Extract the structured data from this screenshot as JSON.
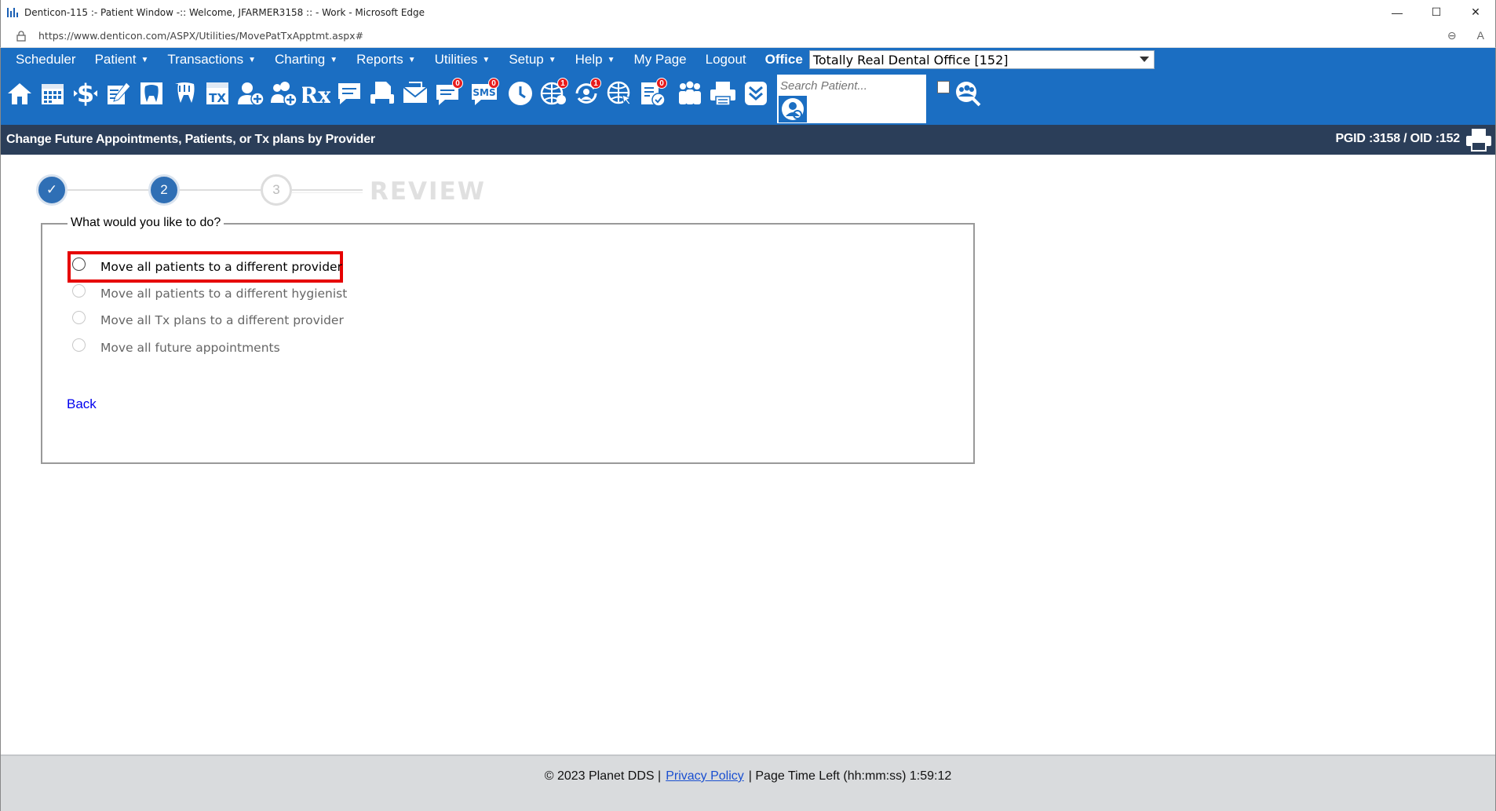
{
  "window": {
    "title": "Denticon-115 :- Patient Window -:: Welcome, JFARMER3158 :: - Work - Microsoft Edge",
    "url": "https://www.denticon.com/ASPX/Utilities/MovePatTxApptmt.aspx#"
  },
  "menu": {
    "items": [
      {
        "label": "Scheduler",
        "caret": false
      },
      {
        "label": "Patient",
        "caret": true
      },
      {
        "label": "Transactions",
        "caret": true
      },
      {
        "label": "Charting",
        "caret": true
      },
      {
        "label": "Reports",
        "caret": true
      },
      {
        "label": "Utilities",
        "caret": true
      },
      {
        "label": "Setup",
        "caret": true
      },
      {
        "label": "Help",
        "caret": true
      },
      {
        "label": "My Page",
        "caret": false
      },
      {
        "label": "Logout",
        "caret": false
      }
    ],
    "office_label": "Office",
    "office_value": "Totally Real Dental Office [152]"
  },
  "toolbar": {
    "badges": {
      "messages": "0",
      "sms": "0",
      "web": "1",
      "sync": "1",
      "forms": "0"
    },
    "sms_text": "SMS",
    "tx_text": "TX",
    "search_placeholder": "Search Patient..."
  },
  "page": {
    "title": "Change Future Appointments, Patients, or Tx plans by Provider",
    "ids": "PGID :3158  /  OID :152"
  },
  "wizard": {
    "step1": "✓",
    "step2": "2",
    "step3": "3",
    "review": "REVIEW"
  },
  "form": {
    "legend": "What would you like to do?",
    "options": [
      {
        "label": "Move all patients to a different provider",
        "enabled": true
      },
      {
        "label": "Move all patients to a different hygienist",
        "enabled": false
      },
      {
        "label": "Move all Tx plans to a different provider",
        "enabled": false
      },
      {
        "label": "Move all future appointments",
        "enabled": false
      }
    ],
    "back": "Back"
  },
  "footer": {
    "copyright": "© 2023 Planet DDS |",
    "privacy": "Privacy Policy",
    "time_left": "|  Page Time Left (hh:mm:ss) 1:59:12"
  },
  "colors": {
    "menu_blue": "#1b6ec2",
    "header_navy": "#2b3e59",
    "highlight_red": "#e60000",
    "step_blue": "#2f6fb5"
  }
}
